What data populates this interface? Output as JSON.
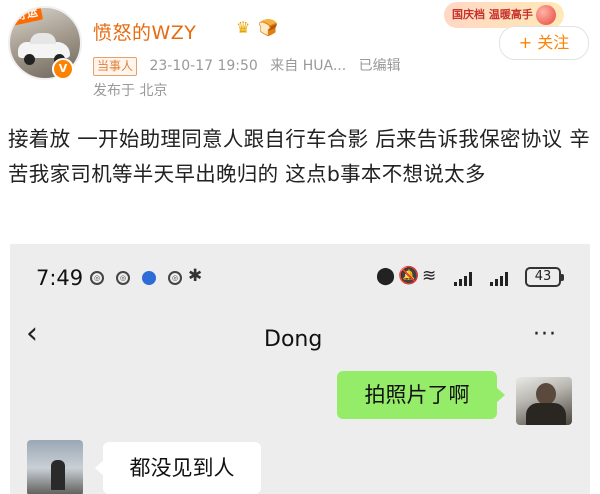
{
  "post": {
    "avatar_tag": "好运",
    "verified_mark": "V",
    "username": "愤怒的WZY",
    "crown_icon": "♛",
    "bread_icon": "🍞",
    "role_badge": "当事人",
    "timestamp": "23-10-17 19:50",
    "source": "来自 HUA...",
    "edited": "已编辑",
    "location": "发布于 北京",
    "event_badge": "国庆档 温暖高手",
    "follow_label": "+ 关注",
    "text": "接着放 一开始助理同意人跟自行车合影 后来告诉我保密协议 辛苦我家司机等半天早出晚归的 这点b事本不想说太多"
  },
  "screenshot": {
    "time": "7:49",
    "battery": "43",
    "chat_title": "Dong",
    "back_icon": "‹",
    "more_icon": "···",
    "messages": [
      {
        "side": "out",
        "text": "拍照片了啊"
      },
      {
        "side": "in",
        "text": "都没见到人"
      }
    ]
  },
  "colors": {
    "username": "#e86b10",
    "follow": "#ff8200",
    "bubble_out": "#95ec69",
    "chat_bg": "#ededed"
  }
}
